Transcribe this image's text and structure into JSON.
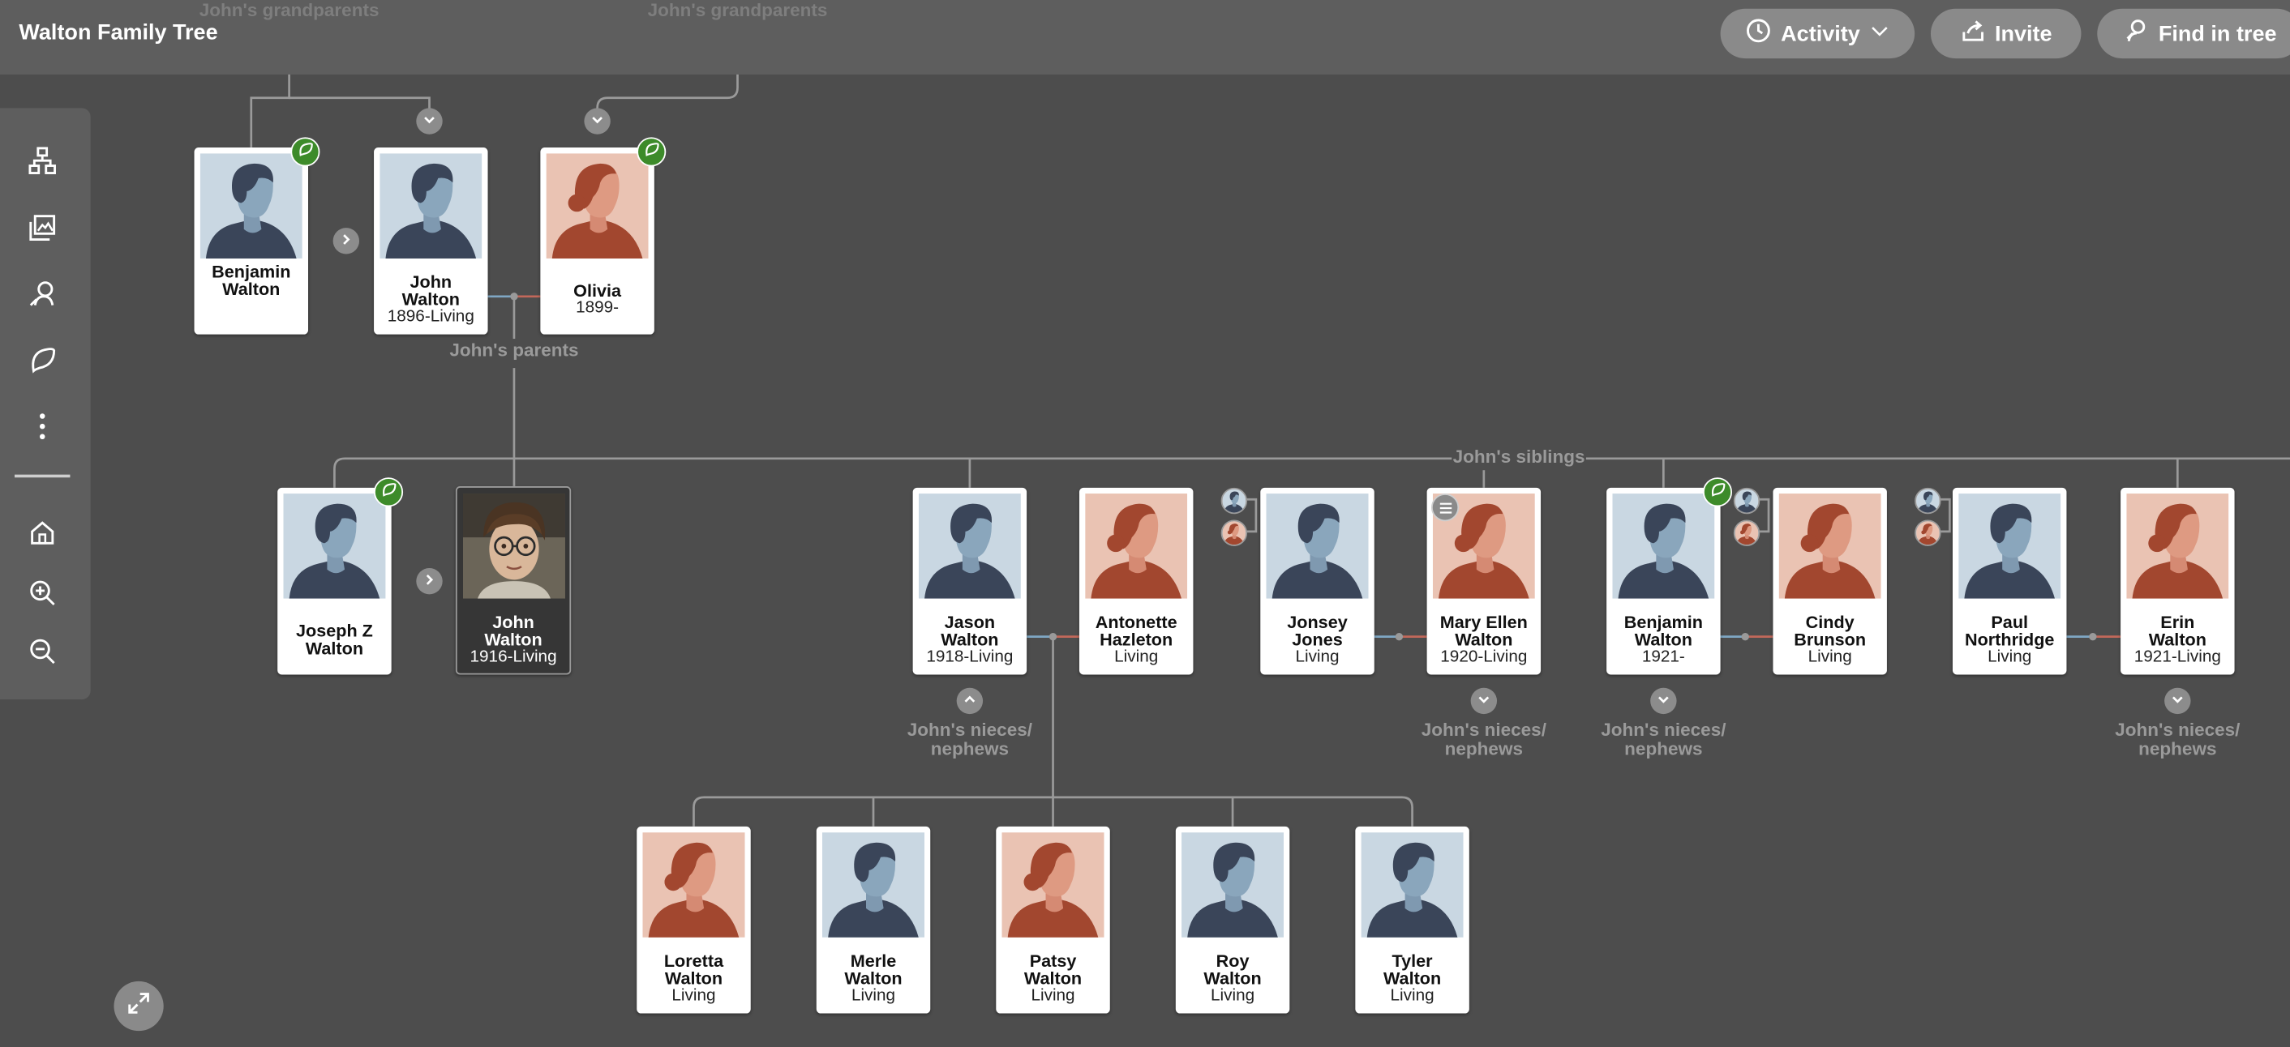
{
  "header": {
    "title": "Walton Family Tree",
    "activity_label": "Activity",
    "invite_label": "Invite",
    "find_label": "Find in tree"
  },
  "groups": {
    "grandparents_left": "John's grandparents",
    "grandparents_right": "John's grandparents",
    "parents": "John's parents",
    "siblings": "John's siblings",
    "nieces_1_line1": "John's nieces/",
    "nieces_1_line2": "nephews",
    "nieces_2_line1": "John's nieces/",
    "nieces_2_line2": "nephews",
    "nieces_3_line1": "John's nieces/",
    "nieces_3_line2": "nephews",
    "nieces_4_line1": "John's nieces/",
    "nieces_4_line2": "nephews"
  },
  "sidebar": {
    "items": [
      "tree-view-icon",
      "media-icon",
      "search-person-icon",
      "hints-leaf-icon",
      "more-icon",
      "home-icon",
      "zoom-in-icon",
      "zoom-out-icon"
    ]
  },
  "people": {
    "benjamin_sr": {
      "line1": "Benjamin",
      "line2": "Walton",
      "dates": "",
      "gender": "male"
    },
    "john_sr": {
      "line1": "John",
      "line2": "Walton",
      "dates": "1896-Living",
      "gender": "male"
    },
    "olivia": {
      "line1": "Olivia",
      "line2": "",
      "dates": "1899-",
      "gender": "female"
    },
    "joseph_z": {
      "line1": "Joseph Z",
      "line2": "Walton",
      "dates": "",
      "gender": "male"
    },
    "john_focus": {
      "line1": "John",
      "line2": "Walton",
      "dates": "1916-Living",
      "gender": "photo"
    },
    "jason": {
      "line1": "Jason",
      "line2": "Walton",
      "dates": "1918-Living",
      "gender": "male"
    },
    "antonette": {
      "line1": "Antonette",
      "line2": "Hazleton",
      "dates": "Living",
      "gender": "female"
    },
    "jonsey": {
      "line1": "Jonsey",
      "line2": "Jones",
      "dates": "Living",
      "gender": "male"
    },
    "mary_ellen": {
      "line1": "Mary Ellen",
      "line2": "Walton",
      "dates": "1920-Living",
      "gender": "female"
    },
    "benjamin_jr": {
      "line1": "Benjamin",
      "line2": "Walton",
      "dates": "1921-",
      "gender": "male"
    },
    "cindy": {
      "line1": "Cindy",
      "line2": "Brunson",
      "dates": "Living",
      "gender": "female"
    },
    "paul": {
      "line1": "Paul",
      "line2": "Northridge",
      "dates": "Living",
      "gender": "male"
    },
    "erin": {
      "line1": "Erin",
      "line2": "Walton",
      "dates": "1921-Living",
      "gender": "female"
    },
    "loretta": {
      "line1": "Loretta",
      "line2": "Walton",
      "dates": "Living",
      "gender": "female"
    },
    "merle": {
      "line1": "Merle",
      "line2": "Walton",
      "dates": "Living",
      "gender": "male"
    },
    "patsy": {
      "line1": "Patsy",
      "line2": "Walton",
      "dates": "Living",
      "gender": "female"
    },
    "roy": {
      "line1": "Roy",
      "line2": "Walton",
      "dates": "Living",
      "gender": "male"
    },
    "tyler": {
      "line1": "Tyler",
      "line2": "Walton",
      "dates": "Living",
      "gender": "male"
    }
  },
  "colors": {
    "background": "#4d4d4d",
    "male_portrait_bg": "#c9d7e2",
    "female_portrait_bg": "#eac3b3",
    "male_line": "#7fa7c4",
    "female_line": "#c2685a",
    "hint_green": "#3d8b2a"
  }
}
